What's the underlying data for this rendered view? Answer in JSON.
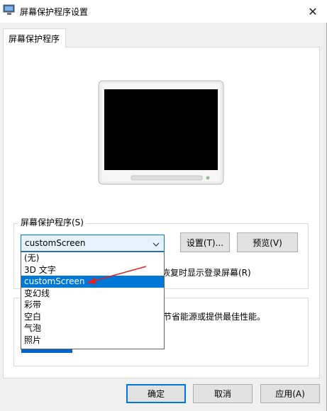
{
  "window": {
    "title": "屏幕保护程序设置",
    "close_glyph": "✕"
  },
  "tab": {
    "label": "屏幕保护程序"
  },
  "screensaver_group": {
    "legend": "屏幕保护程序(S)",
    "selected_value": "customScreen",
    "settings_label": "设置(T)...",
    "preview_label": "预览(V)",
    "resume_text": "恢复时显示登录屏幕(R)"
  },
  "dropdown_options": [
    "(无)",
    "3D 文字",
    "customScreen",
    "变幻线",
    "彩带",
    "空白",
    "气泡",
    "照片"
  ],
  "dropdown_selected_index": 2,
  "power_group": {
    "text": "节省能源或提供最佳性能。"
  },
  "buttons": {
    "ok": "确定",
    "cancel": "取消",
    "apply": "应用(A)"
  },
  "colors": {
    "accent": "#0078d7",
    "annotation_arrow": "#e02020"
  }
}
